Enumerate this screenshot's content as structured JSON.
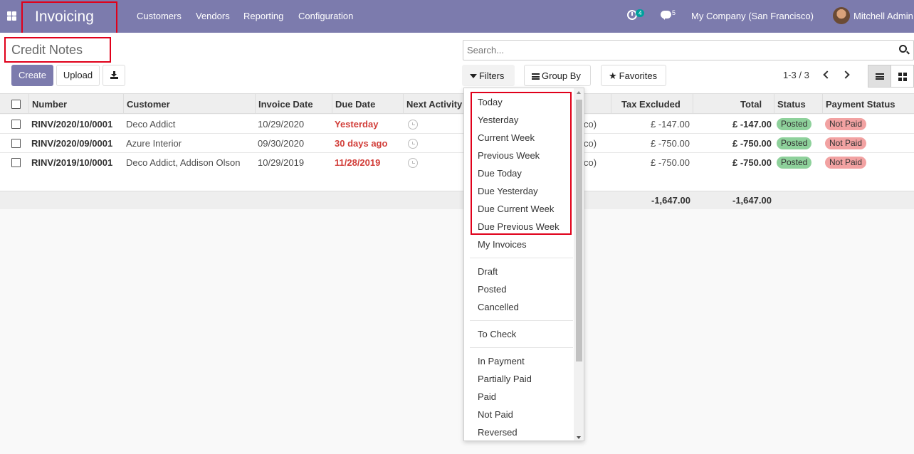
{
  "navbar": {
    "app_title": "Invoicing",
    "menu": [
      "Customers",
      "Vendors",
      "Reporting",
      "Configuration"
    ],
    "activity_count": "4",
    "message_count": "5",
    "company": "My Company (San Francisco)",
    "user": "Mitchell Admin"
  },
  "control": {
    "breadcrumb": "Credit Notes",
    "create_label": "Create",
    "upload_label": "Upload",
    "search_placeholder": "Search...",
    "filters_label": "Filters",
    "groupby_label": "Group By",
    "favorites_label": "Favorites",
    "pager": "1-3 / 3"
  },
  "table": {
    "headers": {
      "number": "Number",
      "customer": "Customer",
      "invoice_date": "Invoice Date",
      "due_date": "Due Date",
      "next_activity": "Next Activity",
      "tax_excluded": "Tax Excluded",
      "total": "Total",
      "status": "Status",
      "payment_status": "Payment Status"
    },
    "rows": [
      {
        "number": "RINV/2020/10/0001",
        "customer": "Deco Addict",
        "invoice_date": "10/29/2020",
        "due_date": "Yesterday",
        "hidden_tail": "co)",
        "tax_excluded": "£ -147.00",
        "total": "£ -147.00",
        "status": "Posted",
        "payment_status": "Not Paid"
      },
      {
        "number": "RINV/2020/09/0001",
        "customer": "Azure Interior",
        "invoice_date": "09/30/2020",
        "due_date": "30 days ago",
        "hidden_tail": "co)",
        "tax_excluded": "£ -750.00",
        "total": "£ -750.00",
        "status": "Posted",
        "payment_status": "Not Paid"
      },
      {
        "number": "RINV/2019/10/0001",
        "customer": "Deco Addict, Addison Olson",
        "invoice_date": "10/29/2019",
        "due_date": "11/28/2019",
        "hidden_tail": "co)",
        "tax_excluded": "£ -750.00",
        "total": "£ -750.00",
        "status": "Posted",
        "payment_status": "Not Paid"
      }
    ],
    "footer": {
      "tax_excluded_total": "-1,647.00",
      "total": "-1,647.00"
    }
  },
  "filters_menu": {
    "group1": [
      "Today",
      "Yesterday",
      "Current Week",
      "Previous Week",
      "Due Today",
      "Due Yesterday",
      "Due Current Week",
      "Due Previous Week",
      "My Invoices"
    ],
    "group2": [
      "Draft",
      "Posted",
      "Cancelled"
    ],
    "group3": [
      "To Check"
    ],
    "group4": [
      "In Payment",
      "Partially Paid",
      "Paid",
      "Not Paid",
      "Reversed"
    ]
  },
  "colors": {
    "brand": "#7c7bad",
    "highlight_border": "#e0001a",
    "overdue_text": "#d23f3a",
    "posted_badge": "#8ed19b",
    "not_paid_badge": "#f2a2a2"
  }
}
